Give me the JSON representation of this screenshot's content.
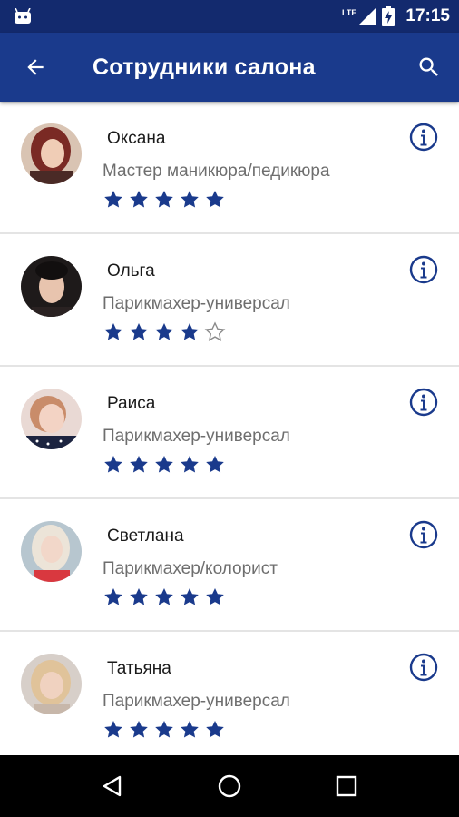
{
  "status_bar": {
    "network_label": "LTE",
    "time": "17:15"
  },
  "app_bar": {
    "title": "Сотрудники салона",
    "back_icon": "arrow-back-icon",
    "search_icon": "search-icon"
  },
  "colors": {
    "primary": "#1a3a8c",
    "status_bar": "#132a6e",
    "star": "#1a3a8c"
  },
  "staff": [
    {
      "name": "Оксана",
      "role": "Мастер маникюра/педикюра",
      "rating": 5
    },
    {
      "name": "Ольга",
      "role": "Парикмахер-универсал",
      "rating": 4
    },
    {
      "name": "Раиса",
      "role": "Парикмахер-универсал",
      "rating": 5
    },
    {
      "name": "Светлана",
      "role": "Парикмахер/колорист",
      "rating": 5
    },
    {
      "name": "Татьяна",
      "role": "Парикмахер-универсал",
      "rating": 5
    }
  ],
  "navigation": {
    "back_icon": "nav-back-icon",
    "home_icon": "nav-home-icon",
    "recents_icon": "nav-recents-icon"
  }
}
